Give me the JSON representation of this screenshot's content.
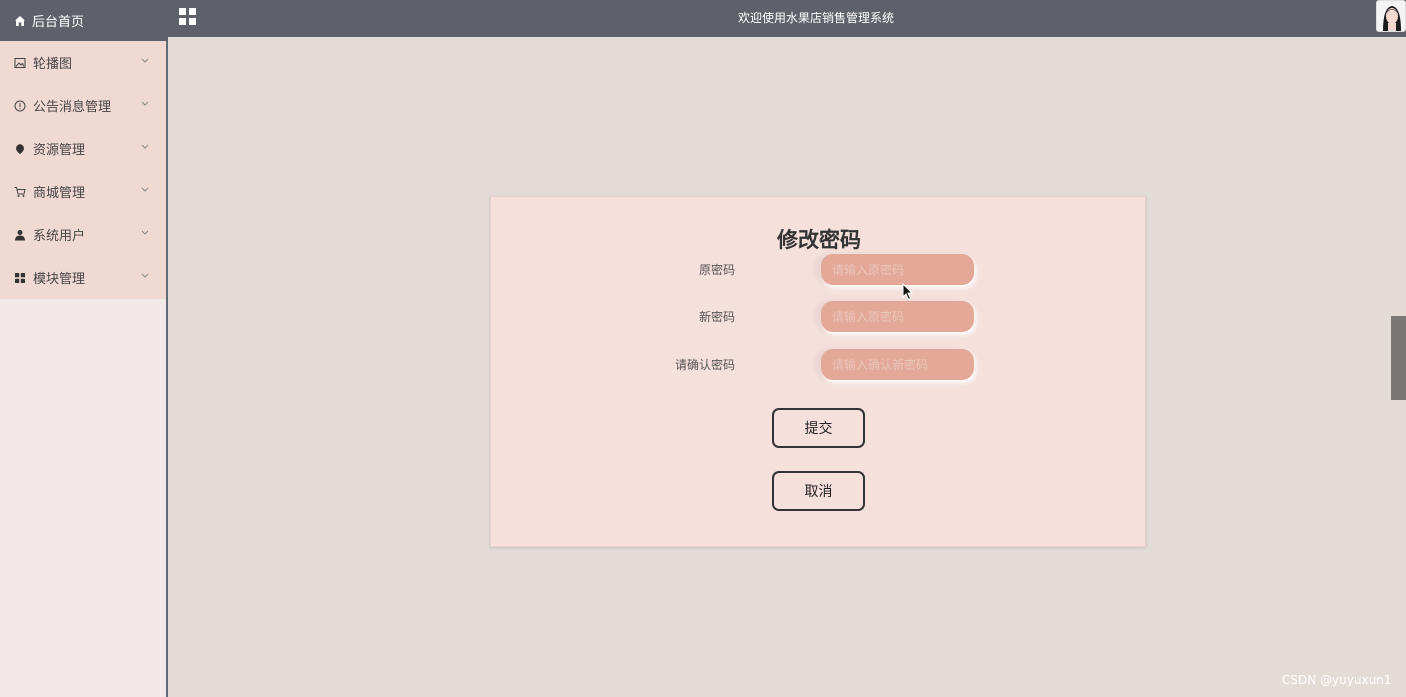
{
  "header": {
    "title": "欢迎使用水果店销售管理系统",
    "home_label": "后台首页"
  },
  "sidebar": {
    "items": [
      {
        "label": "轮播图",
        "icon": "picture-icon"
      },
      {
        "label": "公告消息管理",
        "icon": "info-icon"
      },
      {
        "label": "资源管理",
        "icon": "pin-icon"
      },
      {
        "label": "商城管理",
        "icon": "cart-icon"
      },
      {
        "label": "系统用户",
        "icon": "user-icon"
      },
      {
        "label": "模块管理",
        "icon": "grid-icon"
      }
    ]
  },
  "form": {
    "title": "修改密码",
    "fields": [
      {
        "label": "原密码",
        "placeholder": "请输入原密码"
      },
      {
        "label": "新密码",
        "placeholder": "请输入原密码"
      },
      {
        "label": "请确认密码",
        "placeholder": "请输入确认新密码"
      }
    ],
    "submit_label": "提交",
    "cancel_label": "取消"
  },
  "watermark": "CSDN @yuyuxun1",
  "colors": {
    "topbar": "#5f616a",
    "sidebar_menu": "#f1d9d3",
    "card_bg": "#f5e0dc",
    "input_bg": "#e3a898",
    "page_bg": "#e3dbd6"
  }
}
